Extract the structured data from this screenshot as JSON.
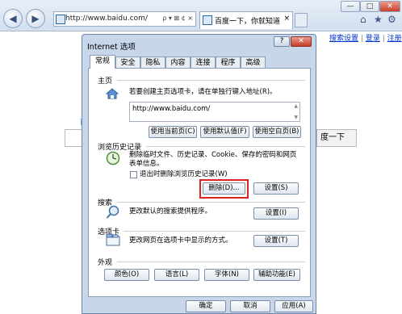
{
  "browser": {
    "address": "http://www.baidu.com/",
    "address_controls": "ρ ▾ ⊠ ¢ ×",
    "tab_title": "百度一下，你就知道",
    "tab_close": "×",
    "win_min": "—",
    "win_max": "□",
    "win_close": "✕",
    "back_glyph": "◀",
    "forward_glyph": "▶",
    "home_glyph": "⌂",
    "star_glyph": "★",
    "gear_glyph": "⚙"
  },
  "page": {
    "links": [
      "搜索设置",
      "登录",
      "注册"
    ],
    "search_button": "度一下",
    "side_char": "首"
  },
  "dialog": {
    "title": "Internet 选项",
    "help": "?",
    "close": "✕",
    "tabs": [
      "常规",
      "安全",
      "隐私",
      "内容",
      "连接",
      "程序",
      "高级"
    ],
    "homepage": {
      "header": "主页",
      "desc": "若要创建主页选项卡，请在单独行键入地址(R)。",
      "url": "http://www.baidu.com/",
      "buttons": [
        "使用当前页(C)",
        "使用默认值(F)",
        "使用空白页(B)"
      ]
    },
    "history": {
      "header": "浏览历史记录",
      "desc1": "删除临时文件、历史记录、Cookie、保存的密码和网页",
      "desc2": "表单信息。",
      "checkbox": "退出时删除浏览历史记录(W)",
      "delete": "删除(D)...",
      "settings": "设置(S)"
    },
    "search": {
      "header": "搜索",
      "desc": "更改默认的搜索提供程序。",
      "settings": "设置(I)"
    },
    "tabsection": {
      "header": "选项卡",
      "desc": "更改网页在选项卡中显示的方式。",
      "settings": "设置(T)"
    },
    "appearance": {
      "header": "外观",
      "buttons": [
        "颜色(O)",
        "语言(L)",
        "字体(N)",
        "辅助功能(E)"
      ]
    },
    "footer": [
      "确定",
      "取消",
      "应用(A)"
    ]
  }
}
